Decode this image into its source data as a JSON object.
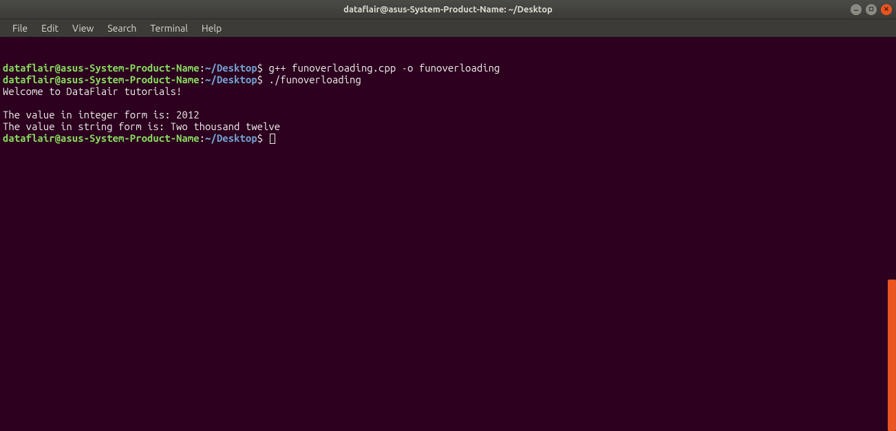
{
  "window": {
    "title": "dataflair@asus-System-Product-Name: ~/Desktop"
  },
  "menubar": {
    "items": [
      "File",
      "Edit",
      "View",
      "Search",
      "Terminal",
      "Help"
    ]
  },
  "prompt": {
    "user_host": "dataflair@asus-System-Product-Name",
    "colon": ":",
    "path_tilde": "~",
    "path_rest": "/Desktop",
    "dollar": "$"
  },
  "lines": [
    {
      "type": "prompt",
      "command": "g++ funoverloading.cpp -o funoverloading"
    },
    {
      "type": "prompt",
      "command": "./funoverloading"
    },
    {
      "type": "output",
      "text": "Welcome to DataFlair tutorials!"
    },
    {
      "type": "blank"
    },
    {
      "type": "output",
      "text": "The value in integer form is: 2012"
    },
    {
      "type": "output",
      "text": "The value in string form is: Two thousand twelve"
    },
    {
      "type": "prompt",
      "command": "",
      "cursor": true
    }
  ]
}
